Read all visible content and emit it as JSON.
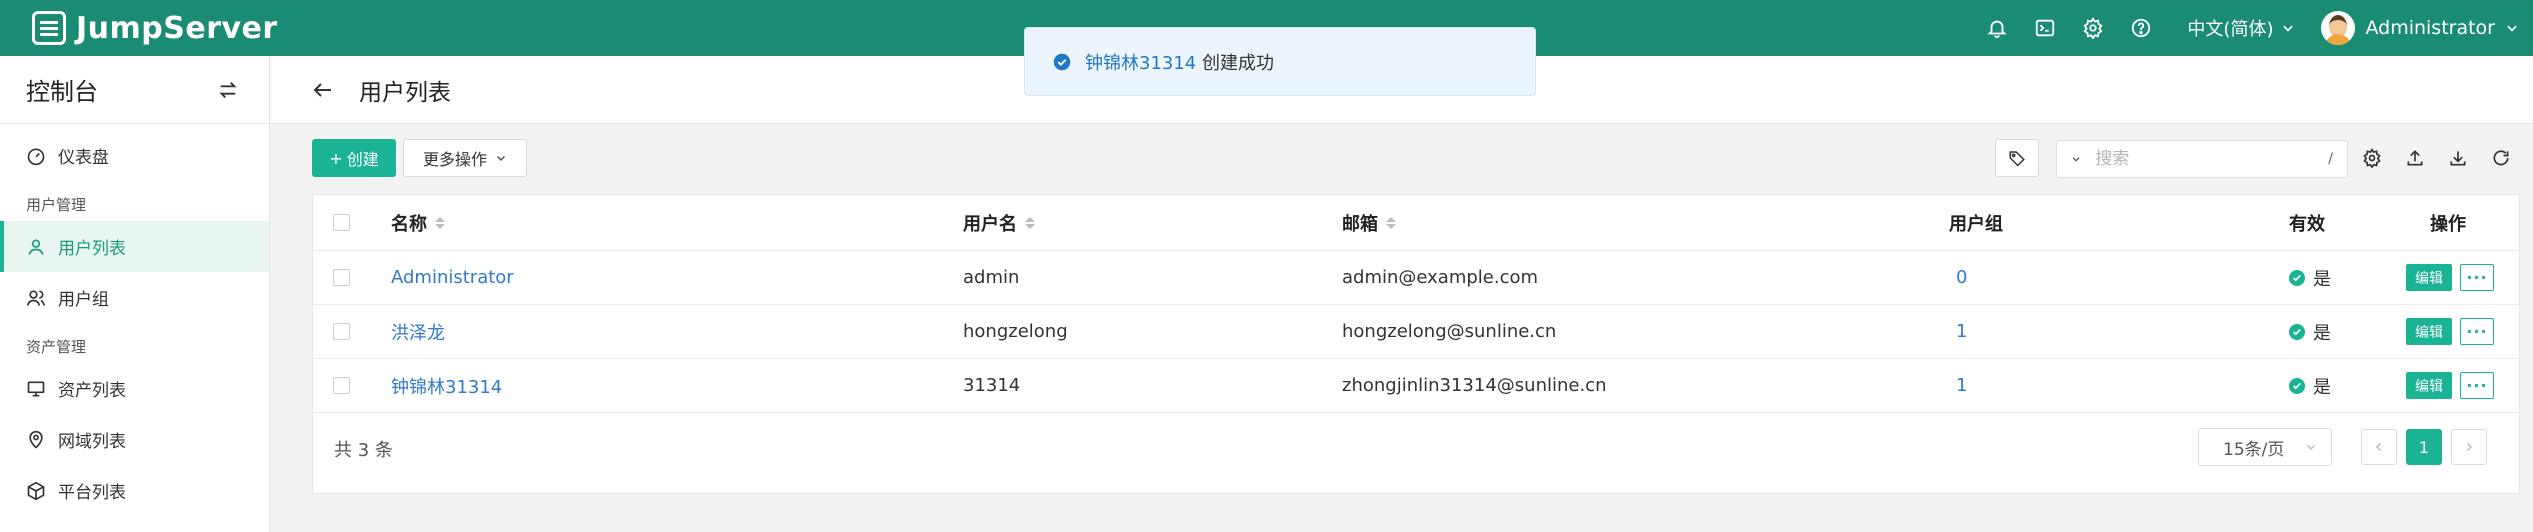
{
  "brand": {
    "name": "JumpServer"
  },
  "topbar": {
    "icons": [
      "bell-icon",
      "terminal-icon",
      "gear-icon",
      "help-icon"
    ],
    "language": "中文(简体)",
    "user": "Administrator"
  },
  "toast": {
    "highlight": "钟锦林31314",
    "message": "创建成功"
  },
  "sidebar": {
    "title": "控制台",
    "items": [
      {
        "label": "仪表盘",
        "icon": "dashboard-icon"
      },
      {
        "group": "用户管理"
      },
      {
        "label": "用户列表",
        "icon": "user-icon",
        "active": true
      },
      {
        "label": "用户组",
        "icon": "users-icon"
      },
      {
        "group": "资产管理"
      },
      {
        "label": "资产列表",
        "icon": "monitor-icon"
      },
      {
        "label": "网域列表",
        "icon": "location-icon"
      },
      {
        "label": "平台列表",
        "icon": "cube-icon"
      }
    ]
  },
  "page": {
    "title": "用户列表"
  },
  "toolbar": {
    "create_label": "创建",
    "more_label": "更多操作",
    "search_placeholder": "搜索",
    "search_shortcut": "/"
  },
  "table": {
    "columns": [
      "名称",
      "用户名",
      "邮箱",
      "用户组",
      "有效",
      "操作"
    ],
    "rows": [
      {
        "name": "Administrator",
        "username": "admin",
        "email": "admin@example.com",
        "groups": "0",
        "valid": "是"
      },
      {
        "name": "洪泽龙",
        "username": "hongzelong",
        "email": "hongzelong@sunline.cn",
        "groups": "1",
        "valid": "是"
      },
      {
        "name": "钟锦林31314",
        "username": "31314",
        "email": "zhongjinlin31314@sunline.cn",
        "groups": "1",
        "valid": "是"
      }
    ],
    "edit_label": "编辑",
    "more_label": "···"
  },
  "pagination": {
    "total": "共 3 条",
    "page_size": "15条/页",
    "current_page": "1"
  },
  "colors": {
    "topbar": "#1a8c74",
    "accent": "#1ab394",
    "link": "#2f7cc9"
  }
}
